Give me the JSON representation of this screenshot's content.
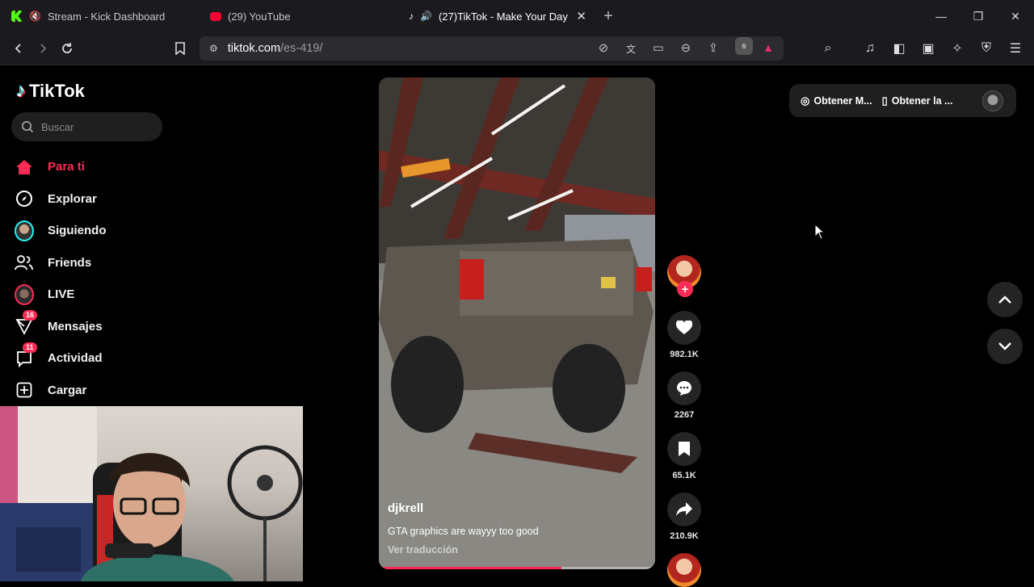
{
  "browser": {
    "tabs": [
      {
        "title": "Stream - Kick Dashboard",
        "favicon_color": "#53fc18",
        "active": false
      },
      {
        "title": "(29) YouTube",
        "favicon_color": "#ff0033",
        "active": false
      },
      {
        "title": "(27)TikTok - Make Your Day",
        "favicon_color": "#ffffff",
        "active": true
      }
    ],
    "url": {
      "host": "tiktok.com",
      "path": "/es-419/"
    },
    "brave_badge_count": "6"
  },
  "tiktok": {
    "brand": "TikTok",
    "search_placeholder": "Buscar",
    "nav": [
      {
        "label": "Para ti",
        "icon": "home-icon",
        "active": true
      },
      {
        "label": "Explorar",
        "icon": "compass-icon"
      },
      {
        "label": "Siguiendo",
        "icon": "following-avatar-icon"
      },
      {
        "label": "Friends",
        "icon": "friends-icon"
      },
      {
        "label": "LIVE",
        "icon": "live-icon"
      },
      {
        "label": "Mensajes",
        "icon": "messages-icon",
        "badge": "16"
      },
      {
        "label": "Actividad",
        "icon": "activity-icon",
        "badge": "11"
      },
      {
        "label": "Cargar",
        "icon": "upload-icon"
      }
    ],
    "video": {
      "username": "djkrell",
      "description": "GTA graphics are wayyy too good",
      "translate": "Ver traducción",
      "progress": 0.66
    },
    "actions": {
      "likes": "982.1K",
      "comments": "2267",
      "saves": "65.1K",
      "shares": "210.9K"
    },
    "top_right": {
      "get_app_label": "Obtener M...",
      "get_device_label": "Obtener la ..."
    },
    "accent_color": "#fe2c55"
  }
}
